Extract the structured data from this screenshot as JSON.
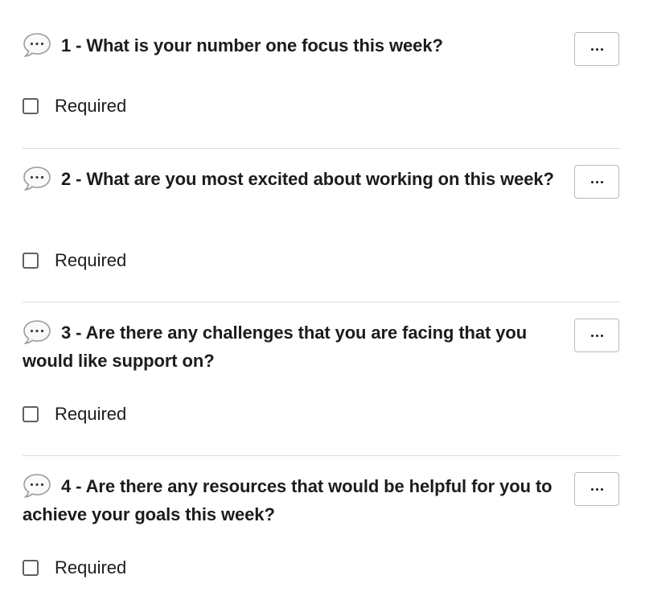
{
  "questions": [
    {
      "title": "1 - What is your number one focus this week?",
      "required_label": "Required",
      "required_checked": false,
      "menu_icon": "more-horizontal-icon",
      "bubble_icon": "speech-bubble-icon"
    },
    {
      "title": "2 - What are you most excited about working on this week?",
      "required_label": "Required",
      "required_checked": false,
      "menu_icon": "more-horizontal-icon",
      "bubble_icon": "speech-bubble-icon"
    },
    {
      "title": "3 - Are there any challenges that you are facing that you would like support on?",
      "required_label": "Required",
      "required_checked": false,
      "menu_icon": "more-horizontal-icon",
      "bubble_icon": "speech-bubble-icon"
    },
    {
      "title": "4 - Are there any resources that would be helpful for you to achieve your goals this week?",
      "required_label": "Required",
      "required_checked": false,
      "menu_icon": "more-horizontal-icon",
      "bubble_icon": "speech-bubble-icon"
    }
  ],
  "colors": {
    "text": "#1d1c1d",
    "divider": "#dddddd",
    "button_border": "#b8b8b8",
    "checkbox_border": "#616061"
  }
}
